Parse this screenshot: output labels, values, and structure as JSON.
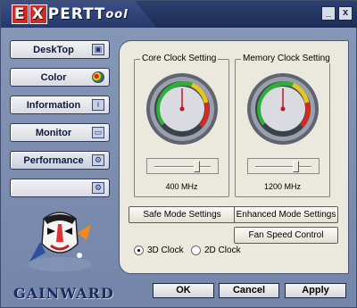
{
  "titlebar": {
    "logo_e": "E",
    "logo_x": "X",
    "logo_pert": "PERT",
    "logo_ool": "ool",
    "minimize": "_",
    "close": "x"
  },
  "sidebar": {
    "items": [
      {
        "label": "DeskTop",
        "icon": "desktop-icon"
      },
      {
        "label": "Color",
        "icon": "palette-icon"
      },
      {
        "label": "Information",
        "icon": "info-icon"
      },
      {
        "label": "Monitor",
        "icon": "monitor-icon"
      },
      {
        "label": "Performance",
        "icon": "performance-icon"
      },
      {
        "label": "",
        "icon": "gears-icon"
      }
    ],
    "active_index": 4
  },
  "brand": "GAINWARD",
  "panel": {
    "core": {
      "title": "Core Clock Setting",
      "value": "400 MHz",
      "slider_fraction": 0.78
    },
    "memory": {
      "title": "Memory Clock Setting",
      "value": "1200 MHz",
      "slider_fraction": 0.75
    },
    "safe_mode_label": "Safe Mode Settings",
    "enhanced_mode_label": "Enhanced Mode Settings",
    "fan_speed_label": "Fan Speed Control",
    "radio_3d_label": "3D Clock",
    "radio_2d_label": "2D Clock",
    "selected_radio": "3D Clock"
  },
  "footer": {
    "ok_label": "OK",
    "cancel_label": "Cancel",
    "apply_label": "Apply"
  },
  "colors": {
    "title_bar": "#1c2c55",
    "window_bg": "#7d8fb0",
    "panel_bg": "#ebe9dd",
    "accent_red": "#d12a1f"
  }
}
